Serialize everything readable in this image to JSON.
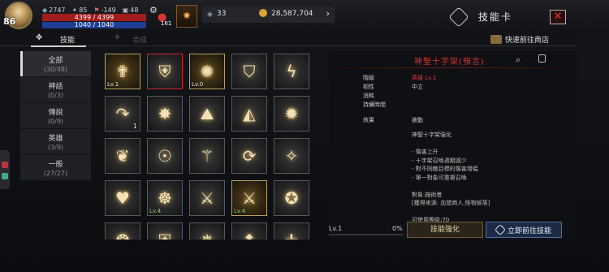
{
  "player": {
    "level": "86",
    "stat_1": "2747",
    "stat_2": "85",
    "stat_3": "-149",
    "stat_4": "48",
    "hp": "4399 / 4399",
    "mp": "1040 / 1040",
    "potion_count": "161"
  },
  "resources": {
    "crystal": "33",
    "gold": "28,587,704",
    "arrow": "›"
  },
  "header": {
    "title": "技能卡",
    "close": "✕"
  },
  "tabs": {
    "skills": "技能",
    "compose": "合成",
    "shop": "快速前往商店"
  },
  "categories": [
    {
      "name": "全部",
      "count": "(30/48)"
    },
    {
      "name": "神話",
      "count": "(0/3)"
    },
    {
      "name": "傳說",
      "count": "(0/9)"
    },
    {
      "name": "英雄",
      "count": "(3/9)"
    },
    {
      "name": "一般",
      "count": "(27/27)"
    }
  ],
  "skills": [
    {
      "glyph": "✟",
      "level": "Lv.1",
      "count": "",
      "selected": true,
      "rare": true
    },
    {
      "glyph": "⛨",
      "level": "",
      "count": "",
      "selected": true,
      "rare": false
    },
    {
      "glyph": "✺",
      "level": "Lv.0",
      "count": "",
      "selected": true,
      "rare": true
    },
    {
      "glyph": "⛉",
      "level": "",
      "count": "",
      "selected": false,
      "rare": false
    },
    {
      "glyph": "ϟ",
      "level": "",
      "count": "",
      "selected": false,
      "rare": false
    },
    {
      "glyph": "↷",
      "level": "",
      "count": "1",
      "selected": false,
      "rare": false
    },
    {
      "glyph": "✸",
      "level": "",
      "count": "",
      "selected": false,
      "rare": false
    },
    {
      "glyph": "⛰",
      "level": "",
      "count": "",
      "selected": false,
      "rare": false
    },
    {
      "glyph": "◭",
      "level": "",
      "count": "",
      "selected": false,
      "rare": false
    },
    {
      "glyph": "✹",
      "level": "",
      "count": "",
      "selected": false,
      "rare": false
    },
    {
      "glyph": "❦",
      "level": "",
      "count": "",
      "selected": false,
      "rare": false
    },
    {
      "glyph": "☉",
      "level": "",
      "count": "",
      "selected": false,
      "rare": false
    },
    {
      "glyph": "⚚",
      "level": "",
      "count": "",
      "selected": false,
      "rare": false
    },
    {
      "glyph": "⟳",
      "level": "",
      "count": "",
      "selected": false,
      "rare": false
    },
    {
      "glyph": "✧",
      "level": "",
      "count": "",
      "selected": false,
      "rare": false
    },
    {
      "glyph": "♥",
      "level": "",
      "count": "",
      "selected": false,
      "rare": false
    },
    {
      "glyph": "☸",
      "level": "Lv.4",
      "count": "",
      "selected": false,
      "rare": false
    },
    {
      "glyph": "⚔",
      "level": "",
      "count": "",
      "selected": false,
      "rare": false
    },
    {
      "glyph": "⚔",
      "level": "Lv.4",
      "count": "",
      "selected": false,
      "rare": true
    },
    {
      "glyph": "✪",
      "level": "",
      "count": "",
      "selected": false,
      "rare": false
    },
    {
      "glyph": "❂",
      "level": "",
      "count": "",
      "selected": false,
      "rare": false
    },
    {
      "glyph": "⛨",
      "level": "",
      "count": "",
      "selected": false,
      "rare": false
    },
    {
      "glyph": "✵",
      "level": "",
      "count": "",
      "selected": false,
      "rare": false
    },
    {
      "glyph": "⬆",
      "level": "",
      "count": "",
      "selected": false,
      "rare": false
    },
    {
      "glyph": "✛",
      "level": "",
      "count": "",
      "selected": false,
      "rare": false
    }
  ],
  "detail": {
    "name": "神聖十字架(預言)",
    "rows": [
      {
        "k": "階級",
        "v": "英雄 Lv.1",
        "red": true
      },
      {
        "k": "相性",
        "v": "中立",
        "red": false
      },
      {
        "k": "消耗",
        "v": "",
        "red": false
      },
      {
        "k": "持續時間",
        "v": "",
        "red": false
      },
      {
        "k": "效果",
        "v": "被動",
        "red": false
      }
    ],
    "desc": [
      "神聖十字架強化",
      "",
      "- 傷害上升",
      "- 十字架召喚週期減少",
      "- 對不同敵目標的傷害增幅",
      "- 單一對象可重複召喚",
      "",
      "對象:施術者",
      "[獲得來源: 血盟商人,怪物掉落]",
      "",
      "可使用等級:70"
    ]
  },
  "footer": {
    "level": "Lv.1",
    "percent": "0%",
    "progress": 0,
    "enhance": "技能強化",
    "goto": "立即前往技能"
  },
  "colors": {
    "accent_red": "#d53030",
    "gold": "#d8a531"
  }
}
